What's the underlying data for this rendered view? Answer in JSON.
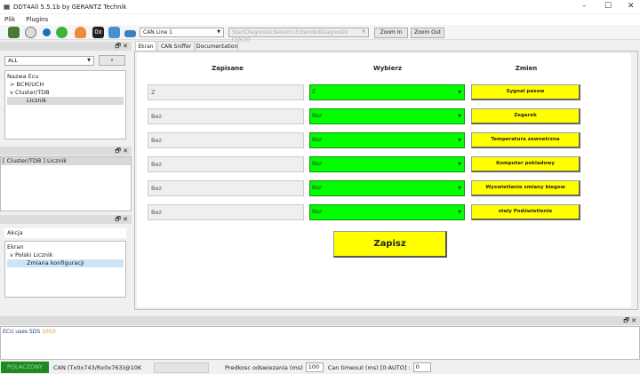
{
  "window": {
    "title": "DDT4All 5.5.1b by GERANTZ Technik",
    "minimize": "–",
    "maximize": "☐",
    "close": "✕"
  },
  "menu": [
    "Plik",
    "Plugins"
  ],
  "toolbar": {
    "can_line": "CAN Line 1",
    "session": "StartDiagnosticSession.ExtendedDiagnostic [10C0]",
    "zoom_in": "Zoom In",
    "zoom_out": "Zoom Out",
    "icons": [
      "ecu-connect-icon",
      "ecu-scan-icon",
      "refresh-icon",
      "green-circle-icon",
      "heart-icon",
      "hex-icon",
      "settings-icon",
      "network-icon"
    ]
  },
  "left": {
    "panel_controls": "🗗 ✕",
    "filter": "ALL",
    "tree_header": "Nazwa Ecu",
    "tree": [
      {
        "toggle": ">",
        "label": "BCM/UCH"
      },
      {
        "toggle": "v",
        "label": "Cluster/TDB"
      },
      {
        "label": "Licznik"
      }
    ],
    "selected_ecu": "[ Cluster/TDB ] Licznik",
    "akcja": "Akcja",
    "screens_header": "Ekran",
    "screens": [
      {
        "toggle": "v",
        "label": "Polski Licznik"
      },
      {
        "label": "Zmiana konfiguracji"
      }
    ]
  },
  "tabs": [
    "Ekran",
    "CAN Sniffer",
    "Documentation"
  ],
  "form": {
    "headers": {
      "saved": "Zapisane",
      "choose": "Wybierz",
      "change": "Zmien"
    },
    "rows": [
      {
        "saved": "Z",
        "choice": "Z",
        "button": "Sygnal pasow"
      },
      {
        "saved": "Bez",
        "choice": "Bez",
        "button": "Zegarek"
      },
      {
        "saved": "Bez",
        "choice": "Bez",
        "button": "Temperatura zewnetrzna"
      },
      {
        "saved": "Bez",
        "choice": "Bez",
        "button": "Komputer pokladowy"
      },
      {
        "saved": "Bez",
        "choice": "Bez",
        "button": "Wyswietlanie zmiany biegow"
      },
      {
        "saved": "Bez",
        "choice": "Bez",
        "button": "staly Podświetlenie"
      }
    ],
    "save": "Zapisz"
  },
  "log": {
    "text": "ECU uses SDS",
    "code": "10C0"
  },
  "status": {
    "connected": "POLACZONY",
    "can": "CAN (Tx0x743/Rx0x763)@10K",
    "refresh_label": "Predkosc odswiezania (ms)",
    "refresh_value": "100",
    "timeout_label": "Can timeout (ms) [0:AUTO] :",
    "timeout_value": "0"
  },
  "colors": {
    "green": "#00ff00",
    "yellow": "#ffff00",
    "status_green": "#1f8a1f",
    "log_code": "#d4a017"
  }
}
